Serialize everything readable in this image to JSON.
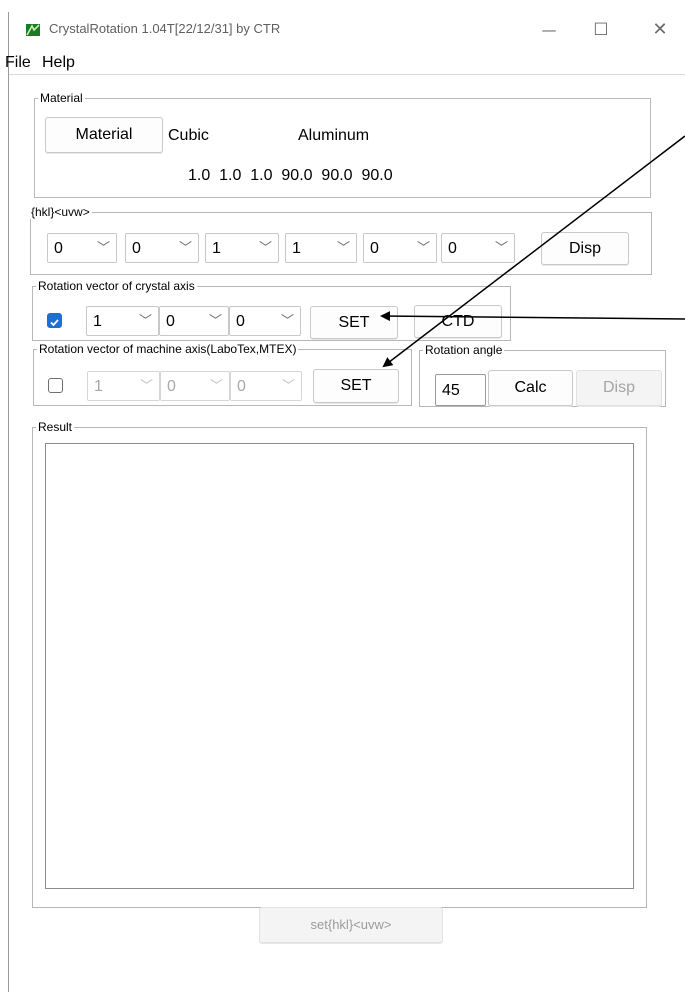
{
  "window": {
    "title": "CrystalRotation 1.04T[22/12/31] by CTR"
  },
  "menu": {
    "file": "File",
    "help": "Help"
  },
  "material": {
    "legend": "Material",
    "button_label": "Material",
    "crystal_system": "Cubic",
    "name": "Aluminum",
    "lattice_params": "1.0  1.0  1.0  90.0  90.0  90.0"
  },
  "hkl": {
    "legend": "{hkl}<uvw>",
    "values": [
      "0",
      "0",
      "1",
      "1",
      "0",
      "0"
    ],
    "disp_label": "Disp"
  },
  "crystal_axis": {
    "legend": "Rotation vector of crystal axis",
    "checked": true,
    "values": [
      "1",
      "0",
      "0"
    ],
    "set_label": "SET",
    "ctd_label": "CTD"
  },
  "machine_axis": {
    "legend": "Rotation vector of machine axis(LaboTex,MTEX)",
    "checked": false,
    "values": [
      "1",
      "0",
      "0"
    ],
    "set_label": "SET"
  },
  "rotation": {
    "legend": "Rotation angle",
    "angle": "45",
    "calc_label": "Calc",
    "disp_label": "Disp"
  },
  "result": {
    "legend": "Result",
    "content": ""
  },
  "footer": {
    "set_button": "set{hkl}<uvw>"
  },
  "colors": {
    "checkbox_checked": "#1f6fd1",
    "arrow": "#000000"
  }
}
